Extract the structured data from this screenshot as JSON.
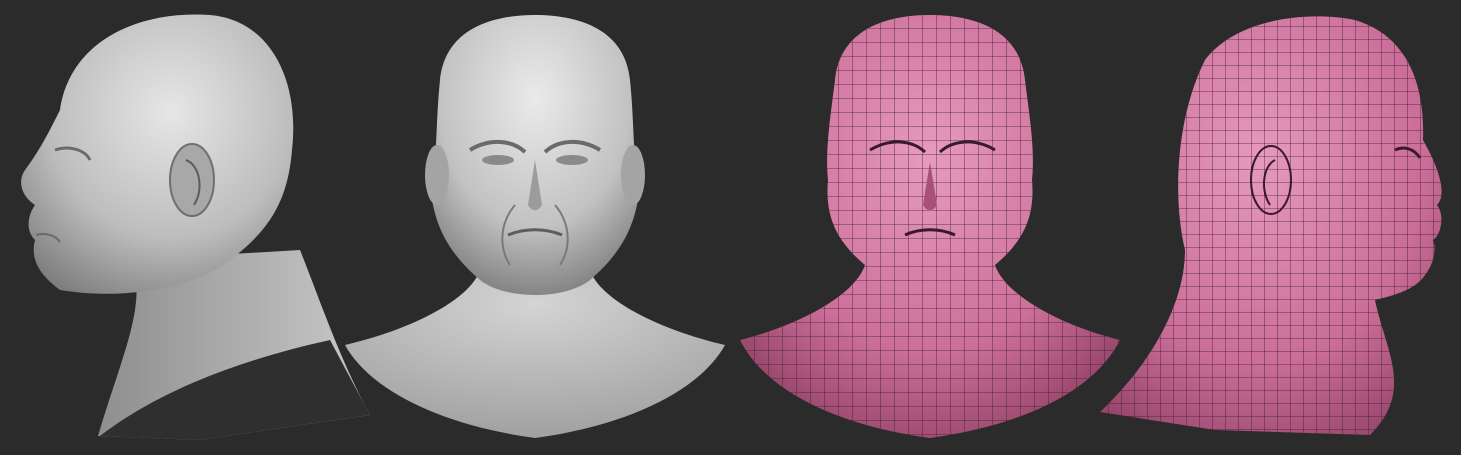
{
  "scene": {
    "background": "#2b2b2b",
    "views": [
      {
        "name": "sculpt-left-profile",
        "material": "clay",
        "color": "#c8c8c8",
        "orientation": "left-profile"
      },
      {
        "name": "sculpt-front",
        "material": "clay",
        "color": "#c8c8c8",
        "orientation": "front"
      },
      {
        "name": "wireframe-front",
        "material": "polypaint",
        "color": "#d07aa3",
        "wire_color": "#3a1a2a",
        "orientation": "front"
      },
      {
        "name": "wireframe-right-profile",
        "material": "polypaint",
        "color": "#d07aa3",
        "wire_color": "#3a1a2a",
        "orientation": "right-profile"
      }
    ]
  }
}
